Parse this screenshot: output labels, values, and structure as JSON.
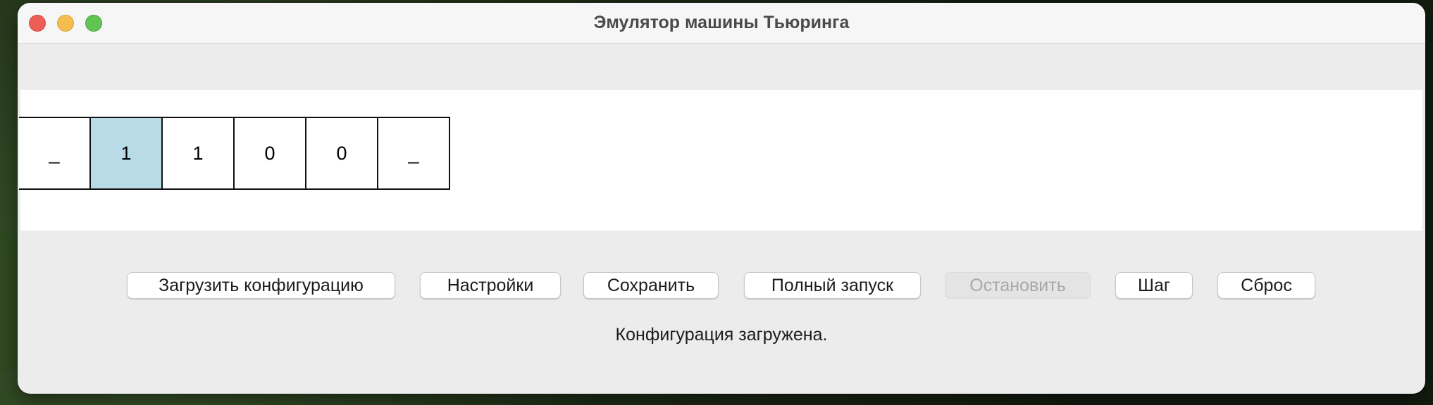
{
  "window": {
    "title": "Эмулятор машины Тьюринга"
  },
  "tape": {
    "cells": [
      "_",
      "1",
      "1",
      "0",
      "0",
      "_"
    ],
    "head_index": 1,
    "head_color": "#b9dbe7"
  },
  "toolbar": {
    "load_label": "Загрузить конфигурацию",
    "settings_label": "Настройки",
    "save_label": "Сохранить",
    "run_label": "Полный запуск",
    "stop_label": "Остановить",
    "step_label": "Шаг",
    "reset_label": "Сброс",
    "stop_enabled": false
  },
  "status": {
    "message": "Конфигурация загружена."
  },
  "colors": {
    "window_bg": "#ececec",
    "close": "#ec5f57",
    "minimize": "#f5bd4f",
    "maximize": "#61c454"
  }
}
